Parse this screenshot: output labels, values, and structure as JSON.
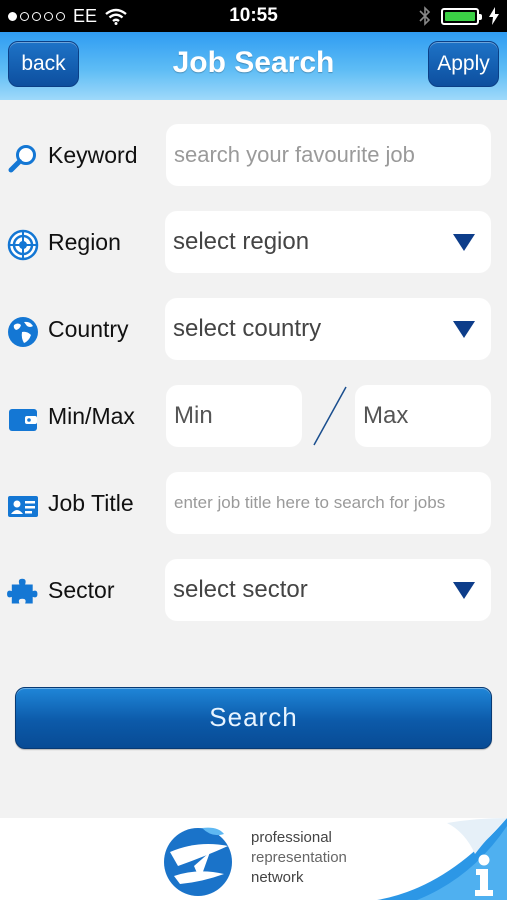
{
  "status_bar": {
    "carrier": "EE",
    "time": "10:55"
  },
  "nav": {
    "back_label": "back",
    "title": "Job Search",
    "apply_label": "Apply"
  },
  "form": {
    "keyword": {
      "label": "Keyword",
      "placeholder": "search your favourite job",
      "icon": "magnifier-icon"
    },
    "region": {
      "label": "Region",
      "value": "select region",
      "icon": "region-target-icon"
    },
    "country": {
      "label": "Country",
      "value": "select country",
      "icon": "globe-icon"
    },
    "minmax": {
      "label": "Min/Max",
      "min_placeholder": "Min",
      "max_placeholder": "Max",
      "icon": "wallet-icon"
    },
    "job_title": {
      "label": "Job Title",
      "placeholder": "enter job title here to search for jobs",
      "icon": "id-card-icon"
    },
    "sector": {
      "label": "Sector",
      "value": "select sector",
      "icon": "puzzle-icon"
    }
  },
  "search_label": "Search",
  "footer": {
    "line1": "professional",
    "line2": "representation",
    "line3": "network"
  },
  "colors": {
    "nav_top": "#2f9cf2",
    "button_blue": "#0c5aa9",
    "icon_blue": "#1477d4",
    "dropdown_arrow": "#0d3d8a"
  }
}
